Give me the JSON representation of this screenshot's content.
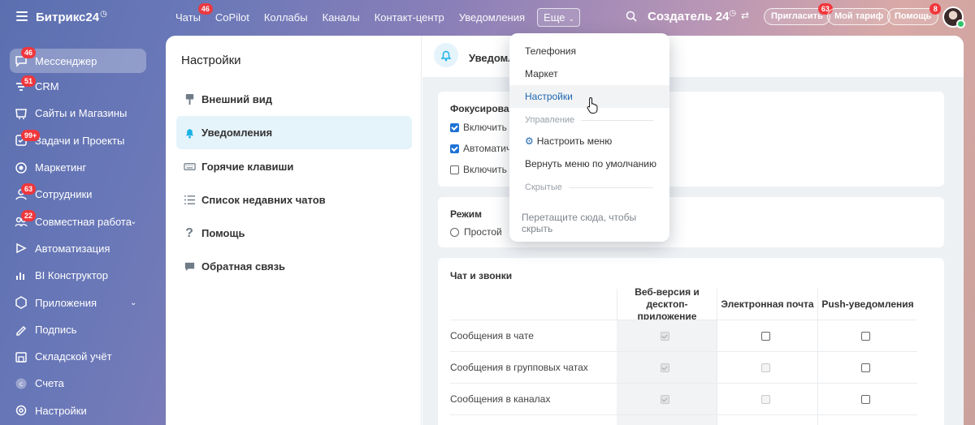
{
  "app": {
    "logo": "Битрикс24",
    "company": "Создатель 24"
  },
  "topnav": {
    "items": [
      {
        "label": "Чаты",
        "badge": "46"
      },
      {
        "label": "CoPilot"
      },
      {
        "label": "Коллабы"
      },
      {
        "label": "Каналы"
      },
      {
        "label": "Контакт-центр"
      },
      {
        "label": "Уведомления"
      }
    ],
    "more_label": "Еще",
    "invite": {
      "label": "Пригласить",
      "badge": "63"
    },
    "tariff": {
      "label": "Мой тариф"
    },
    "help": {
      "label": "Помощь",
      "badge": "8"
    }
  },
  "sidebar": {
    "items": [
      {
        "label": "Мессенджер",
        "badge": "46",
        "icon": "chat-icon",
        "active": true
      },
      {
        "label": "CRM",
        "badge": "51",
        "icon": "crm-icon"
      },
      {
        "label": "Сайты и Магазины",
        "icon": "sites-icon"
      },
      {
        "label": "Задачи и Проекты",
        "badge": "99+",
        "icon": "tasks-icon"
      },
      {
        "label": "Маркетинг",
        "icon": "marketing-icon"
      },
      {
        "label": "Сотрудники",
        "badge": "63",
        "icon": "employees-icon"
      },
      {
        "label": "Совместная работа",
        "badge": "22",
        "icon": "collab-icon",
        "expandable": true
      },
      {
        "label": "Автоматизация",
        "icon": "automation-icon"
      },
      {
        "label": "BI Конструктор",
        "icon": "bi-icon"
      },
      {
        "label": "Приложения",
        "icon": "apps-icon",
        "expandable": true
      },
      {
        "label": "Подпись",
        "icon": "signature-icon"
      },
      {
        "label": "Складской учёт",
        "icon": "warehouse-icon"
      },
      {
        "label": "Счета",
        "icon": "invoices-icon"
      },
      {
        "label": "Настройки",
        "icon": "gear-icon"
      }
    ]
  },
  "settings": {
    "title": "Настройки",
    "menu": [
      {
        "label": "Внешний вид",
        "icon": "brush-icon"
      },
      {
        "label": "Уведомления",
        "icon": "bell-icon",
        "active": true
      },
      {
        "label": "Горячие клавиши",
        "icon": "keyboard-icon"
      },
      {
        "label": "Список недавних чатов",
        "icon": "list-icon"
      },
      {
        "label": "Помощь",
        "icon": "question-icon"
      },
      {
        "label": "Обратная связь",
        "icon": "feedback-icon"
      }
    ],
    "section_title": "Уведомле",
    "focus_card": {
      "title": "Фокусировани",
      "options": [
        {
          "label": "Включить з",
          "checked": true
        },
        {
          "label": "Автоматич",
          "checked": true
        },
        {
          "label": "Включить р",
          "checked": false
        }
      ]
    },
    "mode_card": {
      "title": "Режим",
      "options": [
        {
          "label": "Простой",
          "selected": false
        }
      ]
    },
    "chat_card": {
      "title": "Чат и звонки",
      "columns": [
        "Веб-версия и десктоп-приложение",
        "Электронная почта",
        "Push-уведомления"
      ],
      "rows": [
        {
          "label": "Сообщения в чате",
          "web": "disabled-checked",
          "email": "unchecked",
          "push": "unchecked"
        },
        {
          "label": "Сообщения в групповых чатах",
          "web": "disabled-checked",
          "email": "disabled",
          "push": "unchecked"
        },
        {
          "label": "Сообщения в каналах",
          "web": "disabled-checked",
          "email": "disabled",
          "push": "unchecked"
        }
      ]
    }
  },
  "dropdown": {
    "items": [
      "Телефония",
      "Маркет",
      "Настройки"
    ],
    "manage_title": "Управление",
    "configure_label": "Настроить меню",
    "reset_label": "Вернуть меню по умолчанию",
    "hidden_title": "Скрытые",
    "drag_hint": "Перетащите сюда, чтобы скрыть"
  }
}
